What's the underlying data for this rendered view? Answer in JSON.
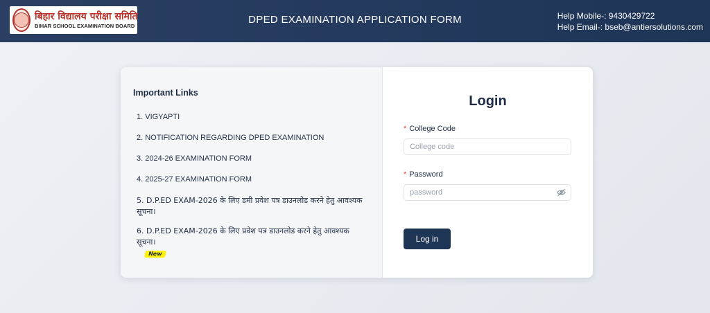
{
  "header": {
    "logo_hindi": "बिहार विद्यालय परीक्षा समिति",
    "logo_english": "BIHAR SCHOOL EXAMINATION BOARD",
    "title": "DPED EXAMINATION APPLICATION FORM",
    "help_mobile": "Help Mobile-: 9430429722",
    "help_email": "Help Email-: bseb@antiersolutions.com"
  },
  "links": {
    "title": "Important Links",
    "items": [
      {
        "label": "1. VIGYAPTI"
      },
      {
        "label": "2. NOTIFICATION REGARDING DPED EXAMINATION"
      },
      {
        "label": "3. 2024-26 EXAMINATION FORM"
      },
      {
        "label": "4. 2025-27 EXAMINATION FORM"
      },
      {
        "label": "5. D.P.ED EXAM-2026 के लिए डमी प्रवेश पत्र डाउनलोड करने हेतु आवश्यक सूचना।"
      },
      {
        "label": "6. D.P.ED EXAM-2026 के लिए प्रवेश पत्र डाउनलोड करने हेतु आवश्यक सूचना।",
        "badge": "New"
      }
    ]
  },
  "login": {
    "title": "Login",
    "college_code_label": "College Code",
    "college_code_placeholder": "College code",
    "college_code_value": "",
    "password_label": "Password",
    "password_placeholder": "password",
    "password_value": "",
    "required_mark": "*",
    "button_label": "Log in"
  },
  "colors": {
    "header_bg": "#243a5e",
    "button_bg": "#1f3556",
    "required": "#e0443b",
    "badge_bg": "#fff200",
    "brand_red": "#b5342b"
  },
  "icons": {
    "password_toggle": "eye-slash-icon",
    "logo": "board-seal-icon"
  }
}
